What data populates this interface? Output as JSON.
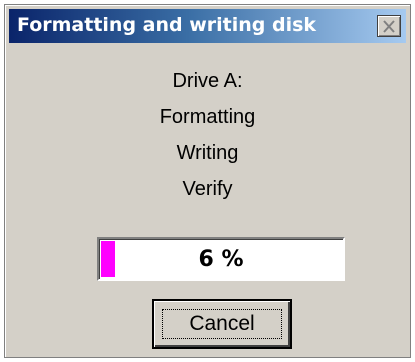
{
  "window": {
    "title": "Formatting and writing disk",
    "close_icon": "close-x-icon"
  },
  "status": {
    "drive": "Drive A:",
    "formatting": "Formatting",
    "writing": "Writing",
    "verify": "Verify"
  },
  "progress": {
    "percent": 6,
    "label": "6 %",
    "fill_color": "#ff00ff"
  },
  "buttons": {
    "cancel": "Cancel"
  },
  "colors": {
    "title_bar_start": "#0a246a",
    "title_bar_end": "#a6caf0",
    "dialog_bg": "#d4d0c8"
  }
}
